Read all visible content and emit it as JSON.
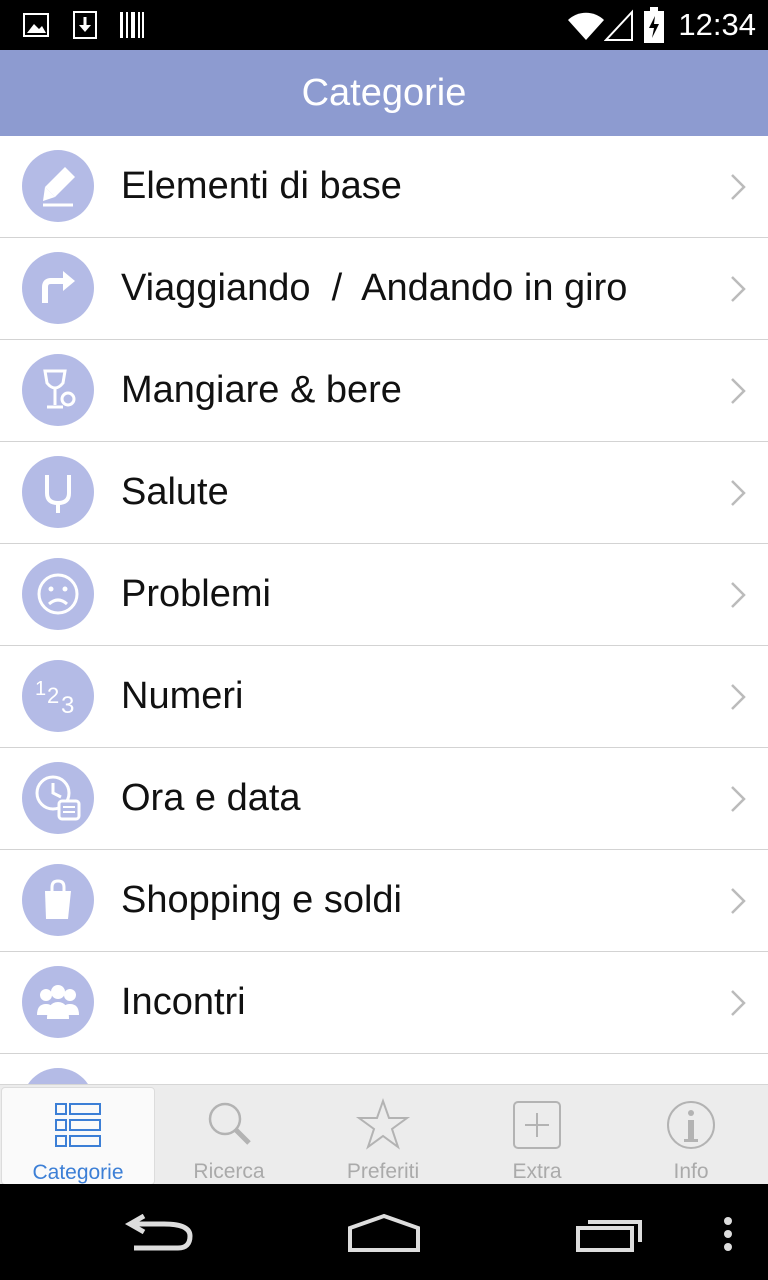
{
  "status_bar": {
    "time": "12:34",
    "icons": [
      "image-icon",
      "download-icon",
      "barcode-icon",
      "wifi-icon",
      "signal-icon",
      "battery-icon"
    ]
  },
  "header": {
    "title": "Categorie"
  },
  "categories": [
    {
      "label": "Elementi di base",
      "icon": "pencil-icon"
    },
    {
      "label": "Viaggiando  /  Andando in giro",
      "icon": "turn-arrow-icon"
    },
    {
      "label": "Mangiare & bere",
      "icon": "glass-icon"
    },
    {
      "label": "Salute",
      "icon": "stethoscope-icon"
    },
    {
      "label": "Problemi",
      "icon": "sad-face-icon"
    },
    {
      "label": "Numeri",
      "icon": "numbers-icon"
    },
    {
      "label": "Ora e data",
      "icon": "clock-icon"
    },
    {
      "label": "Shopping e soldi",
      "icon": "shopping-bag-icon"
    },
    {
      "label": "Incontri",
      "icon": "people-icon"
    }
  ],
  "tabs": [
    {
      "label": "Categorie",
      "icon": "list-icon",
      "selected": true
    },
    {
      "label": "Ricerca",
      "icon": "search-icon",
      "selected": false
    },
    {
      "label": "Preferiti",
      "icon": "star-icon",
      "selected": false
    },
    {
      "label": "Extra",
      "icon": "plus-box-icon",
      "selected": false
    },
    {
      "label": "Info",
      "icon": "info-icon",
      "selected": false
    }
  ],
  "colors": {
    "header_bg": "#8d9bd0",
    "icon_circle": "#b4bbe6",
    "selected_tab_text": "#3c7fd6"
  }
}
